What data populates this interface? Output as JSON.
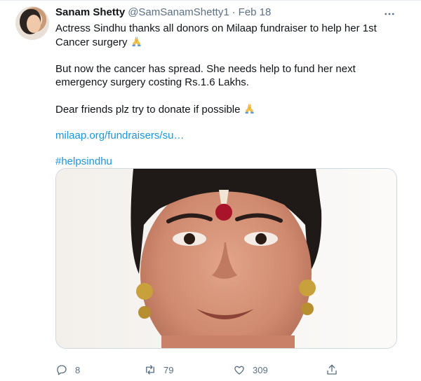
{
  "tweet": {
    "author_name": "Sanam Shetty",
    "author_handle": "@SamSanamShetty1",
    "separator": "·",
    "date": "Feb 18",
    "text": {
      "line1": "Actress Sindhu thanks all donors on Milaap fundraiser to help her 1st Cancer surgery",
      "line2": "But now the cancer has spread. She needs help to fund her next emergency surgery costing Rs.1.6 Lakhs.",
      "line3": "Dear friends plz try to donate if possible",
      "link": "milaap.org/fundraisers/su…",
      "hashtag": "#helpsindhu"
    },
    "actions": {
      "replies": "8",
      "retweets": "79",
      "likes": "309"
    }
  },
  "icons": {
    "more": "more-horizontal-icon",
    "reply": "reply-icon",
    "retweet": "retweet-icon",
    "like": "heart-icon",
    "share": "share-icon",
    "emoji": "folded-hands-emoji"
  },
  "colors": {
    "text": "#0f1419",
    "secondary": "#5b7083",
    "link": "#1b95e0",
    "border": "#cfd9de"
  }
}
